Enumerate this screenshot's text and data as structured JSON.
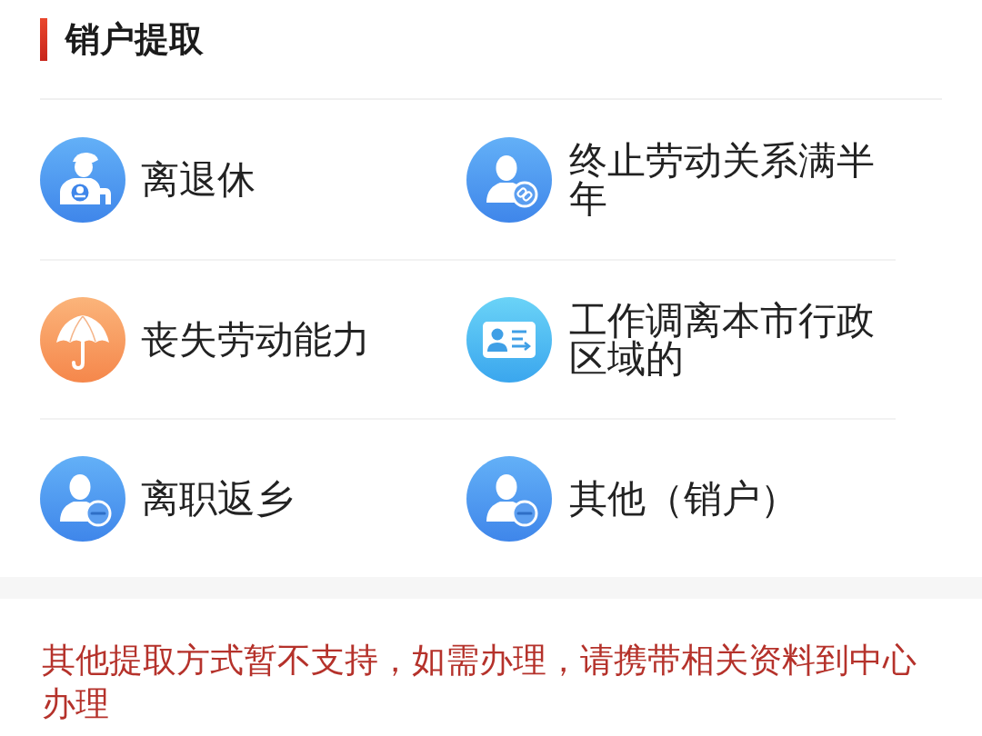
{
  "section": {
    "title": "销户提取"
  },
  "options": [
    {
      "kind": "retiree",
      "label": "离退休"
    },
    {
      "kind": "person-link",
      "label": "终止劳动关系满半年"
    },
    {
      "kind": "umbrella",
      "label": "丧失劳动能力"
    },
    {
      "kind": "id-card",
      "label": "工作调离本市行政区域的"
    },
    {
      "kind": "person-minus",
      "label": "离职返乡"
    },
    {
      "kind": "person-minus",
      "label": "其他（销户）"
    }
  ],
  "notice": "其他提取方式暂不支持，如需办理，请携带相关资料到中心办理"
}
